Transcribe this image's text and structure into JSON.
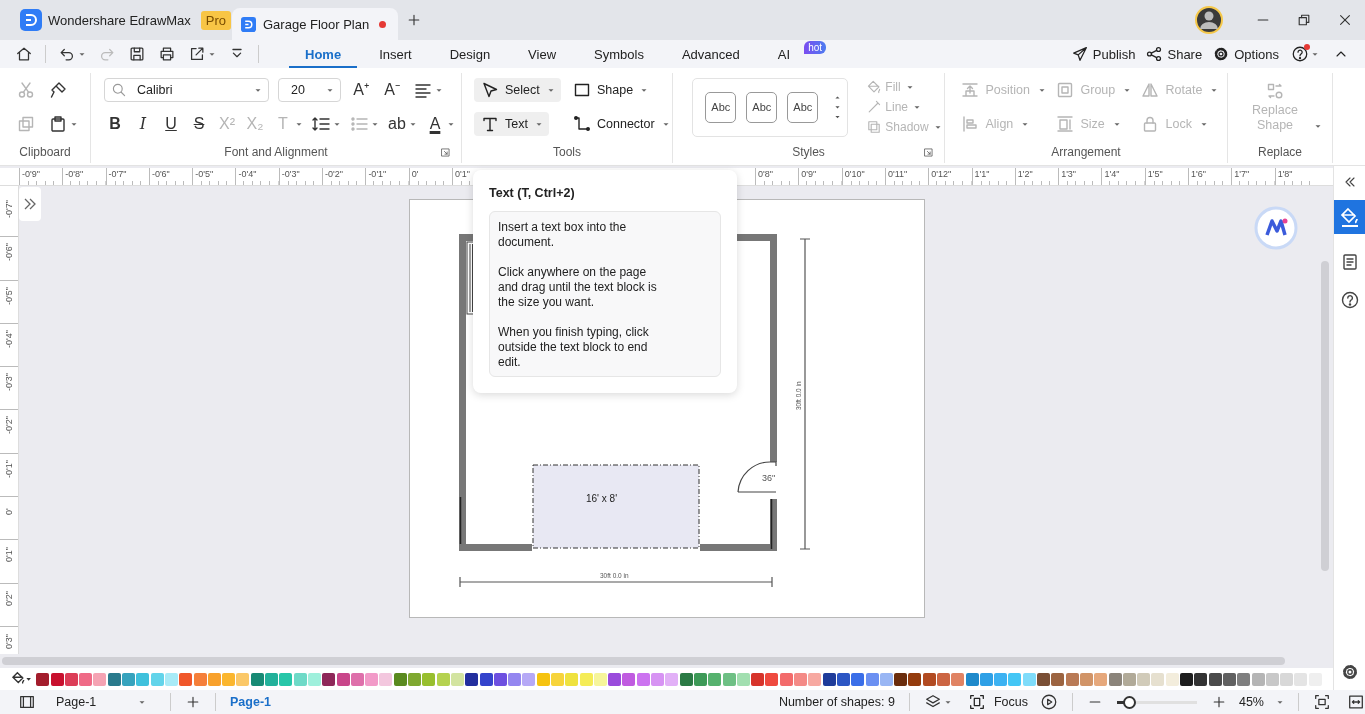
{
  "title_bar": {
    "app_name": "Wondershare EdrawMax",
    "app_badge": "Pro",
    "tabs": [
      {
        "label": "Garage Floor Plan",
        "selected": true,
        "unsaved": true
      }
    ]
  },
  "quick_access": [
    {
      "kind": "home",
      "disabled": false,
      "dropdown": false
    },
    {
      "kind": "undo",
      "disabled": false,
      "dropdown": true
    },
    {
      "kind": "redo",
      "disabled": true,
      "dropdown": false
    },
    {
      "kind": "save",
      "disabled": false,
      "dropdown": false
    },
    {
      "kind": "print",
      "disabled": false,
      "dropdown": false
    },
    {
      "kind": "export",
      "disabled": false,
      "dropdown": true
    },
    {
      "kind": "more",
      "disabled": false,
      "dropdown": false
    }
  ],
  "menu_tabs": [
    {
      "label": "Home",
      "selected": true
    },
    {
      "label": "Insert",
      "selected": false
    },
    {
      "label": "Design",
      "selected": false
    },
    {
      "label": "View",
      "selected": false
    },
    {
      "label": "Symbols",
      "selected": false
    },
    {
      "label": "Advanced",
      "selected": false
    },
    {
      "label": "AI",
      "selected": false,
      "badge": "hot"
    }
  ],
  "menu_actions": [
    {
      "kind": "publish",
      "label": "Publish"
    },
    {
      "kind": "share",
      "label": "Share"
    },
    {
      "kind": "options",
      "label": "Options"
    }
  ],
  "help": {
    "notification": true
  },
  "ribbon": {
    "clipboard": {
      "label": "Clipboard",
      "tools": [
        {
          "kind": "cut",
          "disabled": true,
          "dropdown": false
        },
        {
          "kind": "painter",
          "disabled": false,
          "dropdown": false
        },
        {
          "kind": "copy",
          "disabled": true,
          "dropdown": false
        },
        {
          "kind": "paste",
          "disabled": false,
          "dropdown": true
        }
      ]
    },
    "font": {
      "label": "Font and Alignment",
      "font_family": "Calibri",
      "font_size": "20",
      "top_tools": [
        {
          "kind": "glyph",
          "glyph": "A⁺",
          "disabled": false,
          "dropdown": false
        },
        {
          "kind": "glyph",
          "glyph": "A⁻",
          "disabled": false,
          "dropdown": false
        },
        {
          "kind": "align",
          "disabled": false,
          "dropdown": true
        }
      ],
      "bottom_tools": [
        {
          "kind": "bold",
          "glyph": "B",
          "disabled": false,
          "dropdown": false
        },
        {
          "kind": "italic",
          "glyph": "I",
          "disabled": false,
          "dropdown": false
        },
        {
          "kind": "underline",
          "glyph": "U",
          "disabled": false,
          "dropdown": false
        },
        {
          "kind": "strike",
          "glyph": "S",
          "disabled": false,
          "dropdown": false
        },
        {
          "kind": "glyph",
          "glyph": "X²",
          "disabled": true,
          "dropdown": false
        },
        {
          "kind": "glyph",
          "glyph": "X₂",
          "disabled": true,
          "dropdown": false
        },
        {
          "kind": "glyph",
          "glyph": "T",
          "disabled": true,
          "dropdown": true
        },
        {
          "kind": "linespacing",
          "disabled": false,
          "dropdown": true
        },
        {
          "kind": "bullets",
          "disabled": true,
          "dropdown": true
        },
        {
          "kind": "glyph",
          "glyph": "ab",
          "disabled": false,
          "dropdown": true
        },
        {
          "kind": "font-color",
          "glyph": "A",
          "disabled": false,
          "dropdown": true
        }
      ]
    },
    "tools": {
      "label": "Tools",
      "buttons": [
        {
          "kind": "select",
          "label": "Select",
          "highlighted": true
        },
        {
          "kind": "shape",
          "label": "Shape",
          "highlighted": false
        },
        {
          "kind": "text",
          "label": "Text",
          "highlighted": true
        },
        {
          "kind": "connector",
          "label": "Connector",
          "highlighted": false
        }
      ]
    },
    "styles": {
      "label": "Styles",
      "samples": [
        "Abc",
        "Abc",
        "Abc"
      ],
      "format": [
        {
          "kind": "fill",
          "label": "Fill",
          "disabled": true
        },
        {
          "kind": "line",
          "label": "Line",
          "disabled": true
        },
        {
          "kind": "shadow",
          "label": "Shadow",
          "disabled": true
        }
      ]
    },
    "arrangement": {
      "label": "Arrangement",
      "items": [
        {
          "kind": "position",
          "label": "Position",
          "disabled": true
        },
        {
          "kind": "group",
          "label": "Group",
          "disabled": true
        },
        {
          "kind": "rotate",
          "label": "Rotate",
          "disabled": true
        },
        {
          "kind": "align",
          "label": "Align",
          "disabled": true
        },
        {
          "kind": "size",
          "label": "Size",
          "disabled": true
        },
        {
          "kind": "lock",
          "label": "Lock",
          "disabled": true
        }
      ]
    },
    "replace": {
      "label": "Replace",
      "button": "Replace Shape",
      "disabled": true
    }
  },
  "rulers": {
    "horizontal_left": [
      "-0'9\"",
      "-0'8\"",
      "-0'7\"",
      "-0'6\"",
      "-0'5\"",
      "-0'4\"",
      "-0'3\"",
      "-0'2\"",
      "-0'1\"",
      "0'",
      "0'1\""
    ],
    "horizontal_right": [
      "0'8\"",
      "0'9\"",
      "0'10\"",
      "0'11\"",
      "0'12\"",
      "1'1\"",
      "1'2\"",
      "1'3\"",
      "1'4\"",
      "1'5\"",
      "1'6\"",
      "1'7\"",
      "1'8\""
    ],
    "vertical": [
      "-0'7\"",
      "-0'6\"",
      "-0'5\"",
      "-0'4\"",
      "-0'3\"",
      "-0'2\"",
      "-0'1\"",
      "0'",
      "0'1\"",
      "0'2\"",
      "0'3\""
    ]
  },
  "tooltip": {
    "title": "Text (T, Ctrl+2)",
    "paragraphs": [
      "Insert a text box into the document.",
      "Click anywhere on the page and drag until the text block is the size you want.",
      "When you finish typing, click outside the text block to end edit."
    ]
  },
  "floor_plan": {
    "garage_door_label": "16' x 8'",
    "door_label": "36\"",
    "width_label": "30ft 0.0 in",
    "height_label": "30ft 0.0 in"
  },
  "palette": [
    {
      "color": "#a31d2c"
    },
    {
      "color": "#c8102e"
    },
    {
      "color": "#dc3d57"
    },
    {
      "color": "#ef6a86"
    },
    {
      "color": "#f5a3b3"
    },
    {
      "color": "#2a7a8c"
    },
    {
      "color": "#36a3bd"
    },
    {
      "color": "#3fc1dc"
    },
    {
      "color": "#62d4ea"
    },
    {
      "color": "#a8ebf7"
    },
    {
      "color": "#f0572a"
    },
    {
      "color": "#f57f3a"
    },
    {
      "color": "#f8a12c"
    },
    {
      "color": "#fbb62e"
    },
    {
      "color": "#fbc868"
    },
    {
      "color": "#178a74"
    },
    {
      "color": "#22b19a"
    },
    {
      "color": "#27c6a8"
    },
    {
      "color": "#6edac7"
    },
    {
      "color": "#9ff0dc"
    },
    {
      "color": "#8e2859"
    },
    {
      "color": "#c9468a"
    },
    {
      "color": "#de6faa"
    },
    {
      "color": "#f29ac8"
    },
    {
      "color": "#f3c7de"
    },
    {
      "color": "#5a8a1f"
    },
    {
      "color": "#7fa830"
    },
    {
      "color": "#98bf2e"
    },
    {
      "color": "#b5d24f"
    },
    {
      "color": "#d3e4a0"
    },
    {
      "color": "#232f9e"
    },
    {
      "color": "#3443cc"
    },
    {
      "color": "#6d4fe0"
    },
    {
      "color": "#9486f0"
    },
    {
      "color": "#b6a9f6"
    },
    {
      "color": "#f6c30f"
    },
    {
      "color": "#f7d43a"
    },
    {
      "color": "#efe23e"
    },
    {
      "color": "#f5ec56"
    },
    {
      "color": "#f6f59a"
    },
    {
      "color": "#9a4bdc"
    },
    {
      "color": "#c05be0"
    },
    {
      "color": "#cc73f0"
    },
    {
      "color": "#d793f3"
    },
    {
      "color": "#e2b0f7"
    },
    {
      "color": "#2b7a44"
    },
    {
      "color": "#3d9a57"
    },
    {
      "color": "#56b26e"
    },
    {
      "color": "#6ec084"
    },
    {
      "color": "#a2dfb0"
    },
    {
      "color": "#d7342b"
    },
    {
      "color": "#ef4a3f"
    },
    {
      "color": "#f36b6b"
    },
    {
      "color": "#f48a86"
    },
    {
      "color": "#f7a9a1"
    },
    {
      "color": "#1f3c9a"
    },
    {
      "color": "#2c56c4"
    },
    {
      "color": "#3a6ee8"
    },
    {
      "color": "#6b90f2"
    },
    {
      "color": "#99b6f4"
    },
    {
      "color": "#6b2d0c"
    },
    {
      "color": "#943c0d"
    },
    {
      "color": "#b24b21"
    },
    {
      "color": "#cc6542"
    },
    {
      "color": "#e08363"
    },
    {
      "color": "#1f8acb"
    },
    {
      "color": "#2ea0e6"
    },
    {
      "color": "#3cb2f2"
    },
    {
      "color": "#44c6f5"
    },
    {
      "color": "#7fdcfa"
    },
    {
      "color": "#7a4f35"
    },
    {
      "color": "#9c6440"
    },
    {
      "color": "#b97a55"
    },
    {
      "color": "#d19467"
    },
    {
      "color": "#e6a87b"
    },
    {
      "color": "#8b847a"
    },
    {
      "color": "#b1aa98"
    },
    {
      "color": "#d1cbb9"
    },
    {
      "color": "#e6e0cf"
    },
    {
      "color": "#f3eddc"
    },
    {
      "color": "#1e1e1e"
    },
    {
      "color": "#333333"
    },
    {
      "color": "#4b4b4b"
    },
    {
      "color": "#606060"
    },
    {
      "color": "#7f7f7f"
    },
    {
      "color": "#b5b5b5"
    },
    {
      "color": "#c8c8c8"
    },
    {
      "color": "#d8d8d8"
    },
    {
      "color": "#e4e4e4"
    },
    {
      "color": "#efefef"
    }
  ],
  "status_bar": {
    "page_select": "Page-1",
    "pages": [
      {
        "label": "Page-1",
        "selected": true
      }
    ],
    "shape_count": "Number of shapes: 9",
    "focus": "Focus",
    "zoom": {
      "level": 0.15,
      "value": "45%"
    }
  }
}
